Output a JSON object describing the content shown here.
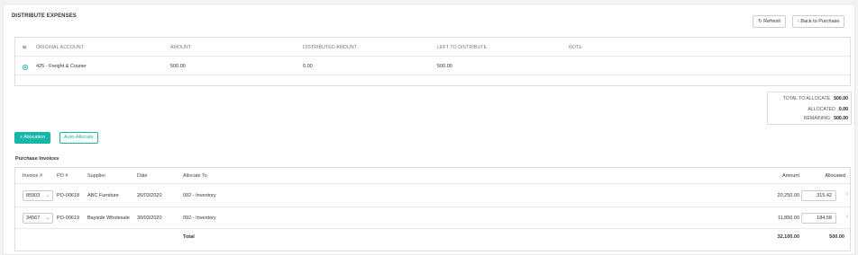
{
  "header": {
    "title": "DISTRIBUTE EXPENSES",
    "refresh_label": "Refresh",
    "back_label": "Back to Purchase"
  },
  "icons": {
    "refresh": "refresh-icon",
    "back": "chevron-left-icon",
    "remove": "close-icon",
    "dropdown": "chevron-down-icon"
  },
  "accounts_table": {
    "columns": [
      "ORIGINAL ACCOUNT",
      "AMOUNT",
      "DISTRIBUTED AMOUNT",
      "LEFT TO DISTRIBUTE",
      "NOTE"
    ],
    "rows": [
      {
        "selected": true,
        "account": "425 - Freight & Courier",
        "amount": "500.00",
        "distributed": "0.00",
        "left": "500.00",
        "note": ""
      }
    ]
  },
  "summary": {
    "total_label": "TOTAL TO ALLOCATE",
    "total_value": "500.00",
    "allocated_label": "ALLOCATED",
    "allocated_value": "0.00",
    "remaining_label": "REMAINING",
    "remaining_value": "500.00"
  },
  "actions": {
    "add_allocation": "+ Allocation",
    "auto_allocate": "Auto-Allocate"
  },
  "invoices": {
    "title": "Purchase Invoices",
    "columns": [
      "Invoice #",
      "PO #",
      "Supplier",
      "Date",
      "Allocate To",
      "Amount",
      "Allocated"
    ],
    "rows": [
      {
        "invoice": "85903",
        "po": "PO-00618",
        "supplier": "ABC Furniture",
        "date": "26/03/2020",
        "allocate_to": "092 - Inventory",
        "amount": "20,250.00",
        "allocated": "315.42"
      },
      {
        "invoice": "34567",
        "po": "PO-00619",
        "supplier": "Bayside Wholesale",
        "date": "30/03/2020",
        "allocate_to": "092 - Inventory",
        "amount": "11,850.00",
        "allocated": "184.58"
      }
    ],
    "total_label": "Total",
    "total_amount": "32,100.00",
    "total_allocated": "500.00"
  },
  "colors": {
    "accent": "#17b6a8"
  }
}
